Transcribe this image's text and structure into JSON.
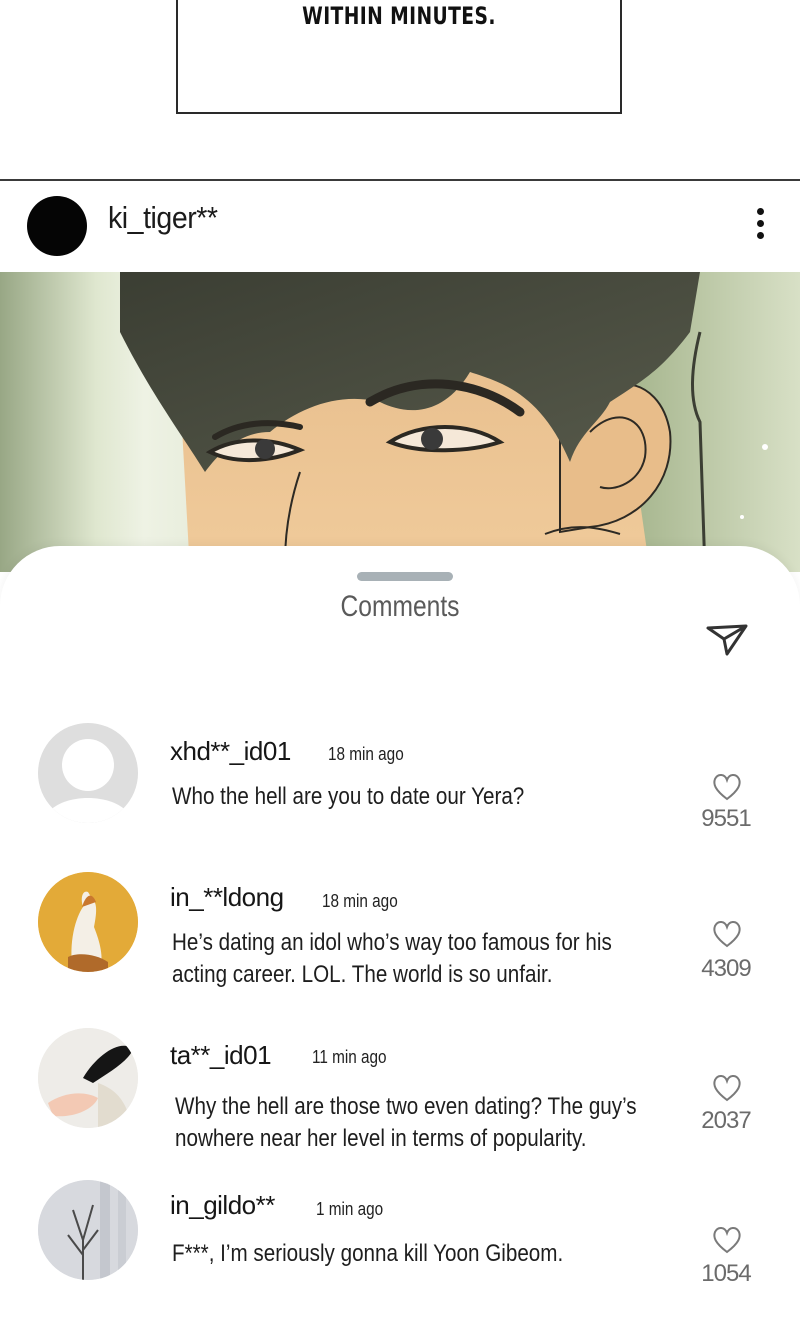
{
  "caption": {
    "text": "WITHIN MINUTES."
  },
  "post": {
    "username": "ki_tiger**",
    "more_icon": "more-vertical-icon"
  },
  "comments_sheet": {
    "title": "Comments",
    "share_icon": "send-icon",
    "items": [
      {
        "username": "xhd**_id01",
        "time": "18 min ago",
        "text_lines": [
          "Who the hell are you to date our Yera?"
        ],
        "likes": "9551",
        "avatar": "default-avatar-icon"
      },
      {
        "username": "in_**ldong",
        "time": "18 min ago",
        "text_lines": [
          "He’s dating an idol who’s way too famous for his",
          "acting career. LOL. The world is so unfair."
        ],
        "likes": "4309",
        "avatar": "cat-photo-avatar"
      },
      {
        "username": "ta**_id01",
        "time": "11 min ago",
        "text_lines": [
          "Why the hell are those two even dating? The guy’s",
          "nowhere near her level in terms of popularity."
        ],
        "likes": "2037",
        "avatar": "black-cat-photo-avatar"
      },
      {
        "username": "in_gildo**",
        "time": "1 min ago",
        "text_lines": [
          "F***, I’m seriously gonna kill Yoon Gibeom."
        ],
        "likes": "1054",
        "avatar": "branches-photo-avatar"
      }
    ]
  },
  "colors": {
    "sheet_bg": "#ffffff",
    "like_count": "#6b6b6b",
    "handle": "#a8b1b6"
  }
}
